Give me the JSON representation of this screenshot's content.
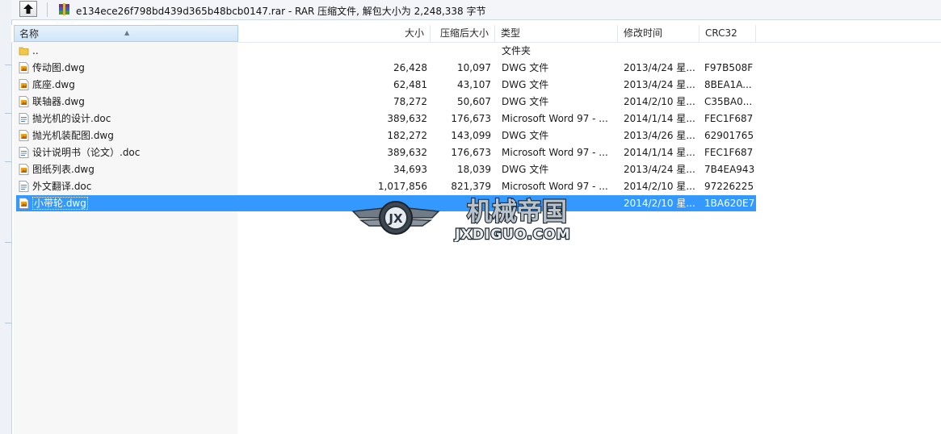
{
  "window": {
    "path_title": "e134ece26f798bd439d365b48bcb0147.rar - RAR 压缩文件, 解包大小为 2,248,338 字节"
  },
  "columns": {
    "name": "名称",
    "size": "大小",
    "packed": "压缩后大小",
    "type": "类型",
    "modified": "修改时间",
    "crc": "CRC32"
  },
  "files": [
    {
      "icon": "folder-up-icon",
      "name": "..",
      "size": "",
      "packed": "",
      "type": "文件夹",
      "modified": "",
      "crc": ""
    },
    {
      "icon": "dwg-file-icon",
      "name": "传动图.dwg",
      "size": "26,428",
      "packed": "10,097",
      "type": "DWG 文件",
      "modified": "2013/4/24 星...",
      "crc": "F97B508F"
    },
    {
      "icon": "dwg-file-icon",
      "name": "底座.dwg",
      "size": "62,481",
      "packed": "43,107",
      "type": "DWG 文件",
      "modified": "2013/4/24 星...",
      "crc": "8BEA1A..."
    },
    {
      "icon": "dwg-file-icon",
      "name": "联轴器.dwg",
      "size": "78,272",
      "packed": "50,607",
      "type": "DWG 文件",
      "modified": "2014/2/10 星...",
      "crc": "C35BA0..."
    },
    {
      "icon": "doc-file-icon",
      "name": "抛光机的设计.doc",
      "size": "389,632",
      "packed": "176,673",
      "type": "Microsoft Word 97 - ...",
      "modified": "2014/1/14 星...",
      "crc": "FEC1F687"
    },
    {
      "icon": "dwg-file-icon",
      "name": "抛光机装配图.dwg",
      "size": "182,272",
      "packed": "143,099",
      "type": "DWG 文件",
      "modified": "2013/4/26 星...",
      "crc": "62901765"
    },
    {
      "icon": "doc-file-icon",
      "name": "设计说明书（论文）.doc",
      "size": "389,632",
      "packed": "176,673",
      "type": "Microsoft Word 97 - ...",
      "modified": "2014/1/14 星...",
      "crc": "FEC1F687"
    },
    {
      "icon": "dwg-file-icon",
      "name": "图纸列表.dwg",
      "size": "34,693",
      "packed": "18,039",
      "type": "DWG 文件",
      "modified": "2013/4/24 星...",
      "crc": "7B4EA943"
    },
    {
      "icon": "doc-file-icon",
      "name": "外文翻译.doc",
      "size": "1,017,856",
      "packed": "821,379",
      "type": "Microsoft Word 97 - ...",
      "modified": "2014/2/10 星...",
      "crc": "97226225"
    },
    {
      "icon": "dwg-file-icon",
      "name": "小带轮.dwg",
      "size": "",
      "packed": "",
      "type": "",
      "modified": "2014/2/10 星...",
      "crc": "1BA620E7",
      "selected": true
    }
  ],
  "watermark": {
    "title": "机械帝国",
    "url": "JXDIGUO.COM",
    "badge": "JX"
  },
  "colors": {
    "selection": "#3399ff",
    "header_active": "#cfe6f8"
  }
}
